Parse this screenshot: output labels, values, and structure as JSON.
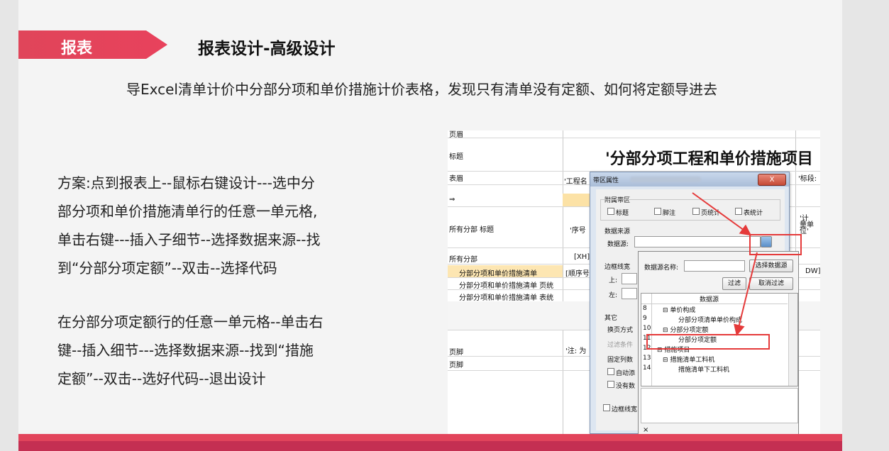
{
  "tag": {
    "label": "报表"
  },
  "title": "报表设计-高级设计",
  "subtitle": "导Excel清单计价中分部分项和单价措施计价表格，发现只有清单没有定额、如何将定额导进去",
  "paragraph1": [
    "方案:点到报表上--鼠标右键设计---选中分",
    "部分项和单价措施清单行的任意一单元格,",
    "单击右键---插入子细节--选择数据来源--找",
    "到“分部分项定额”--双击--选择代码"
  ],
  "paragraph2": [
    "在分部分项定额行的任意一单元格--单击右",
    "键--插入细节---选择数据来源--找到“措施",
    "定额”--双击--选好代码--退出设计"
  ],
  "screenshot": {
    "rows": [
      {
        "label": "页眉"
      },
      {
        "label": "标题"
      },
      {
        "label": "表眉"
      },
      {
        "label": "⇒"
      },
      {
        "label": "所有分部 标题"
      },
      {
        "label": "所有分部"
      },
      {
        "label": "分部分项和单价措施清单"
      },
      {
        "label": "分部分项和单价措施清单 页统"
      },
      {
        "label": "分部分项和单价措施清单 表统"
      },
      {
        "label": "页脚"
      },
      {
        "label": "页脚"
      }
    ],
    "big_title": "'分部分项工程和单价措施项目",
    "cells": {
      "gongcheng": "'工程名",
      "biaoduan": "'标段:",
      "xuhao": "'序号",
      "jiliang": "'计\n量单\n位'",
      "xh": "[XH]",
      "shunxu": "[顺序号",
      "dw": "DW]",
      "zhu": "'注: 为"
    },
    "dialog": {
      "title": "带区属性",
      "close": "X",
      "group_fushu": "附属带区",
      "checks": [
        "标题",
        "脚注",
        "页统计",
        "表统计"
      ],
      "group_source": "数据来源",
      "source_label": "数据源:",
      "border_label": "边框线宽",
      "top_label": "上:",
      "left_label": "左:",
      "other_label": "其它",
      "page_mode": "换页方式",
      "filter_cond": "过滤条件",
      "fixed_cols": "固定列数",
      "auto": "自动添",
      "no_data": "没有数",
      "border_check": "边框线宽"
    },
    "popup": {
      "name_label": "数据源名称:",
      "select_btn": "选择数据源",
      "filter_btn": "过滤",
      "cancel_filter_btn": "取消过滤",
      "header": "数据源",
      "items": [
        {
          "num": "8",
          "text": "⊟ 单价构成"
        },
        {
          "num": "9",
          "text": "分部分项清单单价构成"
        },
        {
          "num": "10",
          "text": "⊟ 分部分项定额"
        },
        {
          "num": "11",
          "text": "分部分项定额"
        },
        {
          "num": "12",
          "text": "⊟ 措施项目"
        },
        {
          "num": "13",
          "text": "⊟ 措施清单工料机"
        },
        {
          "num": "14",
          "text": "措施清单下工料机"
        }
      ],
      "close_x": "×"
    }
  }
}
